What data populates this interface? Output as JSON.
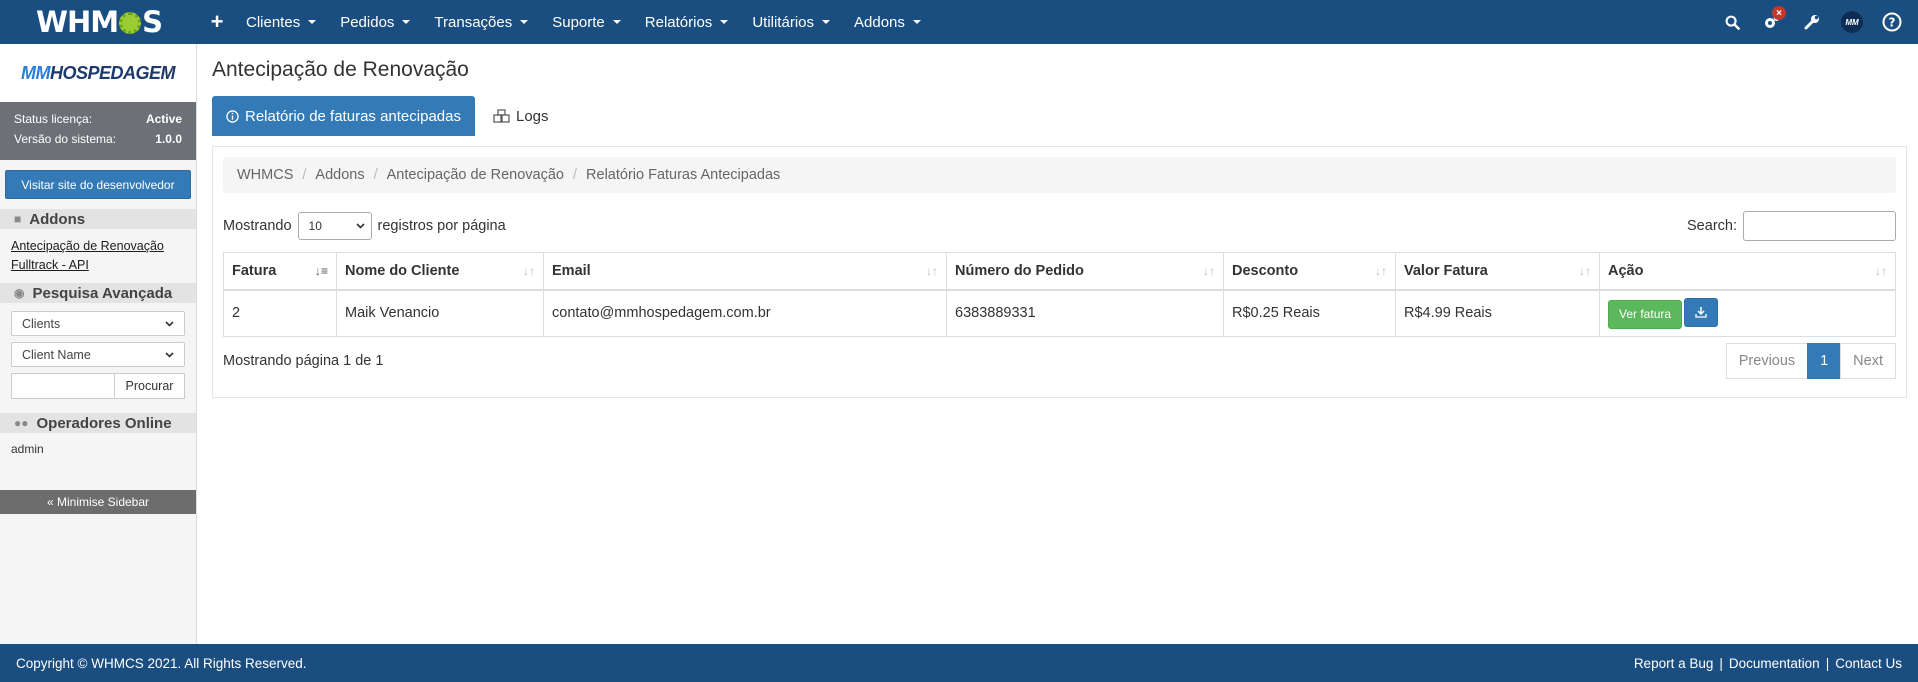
{
  "topnav": {
    "logo": {
      "left": "WHM",
      "right": "S"
    },
    "plus": "+",
    "menu": [
      "Clientes",
      "Pedidos",
      "Transações",
      "Suporte",
      "Relatórios",
      "Utilitários",
      "Addons"
    ],
    "icons": [
      "search-icon",
      "gears-icon",
      "wrench-icon",
      "avatar",
      "help-icon"
    ],
    "badge": "×",
    "avatar_text": "MM"
  },
  "sidebar": {
    "logo": {
      "mm": "MM",
      "rest": "HOSPEDAGEM"
    },
    "status_label": "Status licença:",
    "status_value": "Active",
    "version_label": "Versão do sistema:",
    "version_value": "1.0.0",
    "dev_button": "Visitar site do desenvolvedor",
    "addons_header": "Addons",
    "addon_links": [
      "Antecipação de Renovação",
      "Fulltrack - API"
    ],
    "search_header": "Pesquisa Avançada",
    "search_type": "Clients",
    "search_field": "Client Name",
    "search_button": "Procurar",
    "operators_header": "Operadores Online",
    "operators": [
      "admin"
    ],
    "minimise": "« Minimise Sidebar"
  },
  "main": {
    "title": "Antecipação de Renovação",
    "tab_active": "Relatório de faturas antecipadas",
    "tab_logs": "Logs",
    "breadcrumb": [
      "WHMCS",
      "Addons",
      "Antecipação de Renovação",
      "Relatório Faturas Antecipadas"
    ],
    "show_prefix": "Mostrando",
    "page_length": "10",
    "show_suffix": "registros por página",
    "search_label": "Search:",
    "columns": [
      "Fatura",
      "Nome do Cliente",
      "Email",
      "Número do Pedido",
      "Desconto",
      "Valor Fatura",
      "Ação"
    ],
    "rows": [
      {
        "fatura": "2",
        "cliente": "Maik Venancio",
        "email": "contato@mmhospedagem.com.br",
        "pedido": "6383889331",
        "desconto": "R$0.25 Reais",
        "valor": "R$4.99 Reais",
        "action": "Ver fatura"
      }
    ],
    "info": "Mostrando página 1 de 1",
    "pager": {
      "previous": "Previous",
      "current": "1",
      "next": "Next"
    }
  },
  "footer": {
    "copyright": "Copyright © WHMCS 2021. All Rights Reserved.",
    "report_bug": "Report a Bug",
    "documentation": "Documentation",
    "contact": "Contact Us",
    "separator": "|"
  }
}
